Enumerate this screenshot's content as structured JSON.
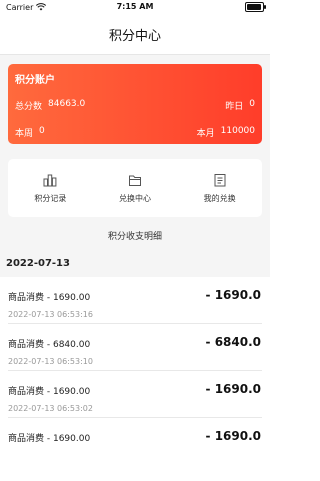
{
  "status_bar": {
    "carrier": "Carrier",
    "time": "7:15 AM"
  },
  "nav": {
    "title": "积分中心"
  },
  "account": {
    "title": "积分账户",
    "total_label": "总分数",
    "total_value": "84663.0",
    "yesterday_label": "昨日",
    "yesterday_value": "0",
    "week_label": "本周",
    "week_value": "0",
    "month_label": "本月",
    "month_value": "110000"
  },
  "quick": {
    "records": {
      "label": "积分记录",
      "icon": "chart-icon"
    },
    "exchange_center": {
      "label": "兑换中心",
      "icon": "box-icon"
    },
    "my_exchange": {
      "label": "我的兑换",
      "icon": "clipboard-icon"
    }
  },
  "section_title": "积分收支明细",
  "date_group": "2022-07-13",
  "transactions": [
    {
      "name": "商品消费 - 1690.00",
      "time": "2022-07-13 06:53:16",
      "amount": "- 1690.0"
    },
    {
      "name": "商品消费 - 6840.00",
      "time": "2022-07-13 06:53:10",
      "amount": "- 6840.0"
    },
    {
      "name": "商品消费 - 1690.00",
      "time": "2022-07-13 06:53:02",
      "amount": "- 1690.0"
    },
    {
      "name": "商品消费 - 1690.00",
      "time": "",
      "amount": "- 1690.0"
    }
  ]
}
